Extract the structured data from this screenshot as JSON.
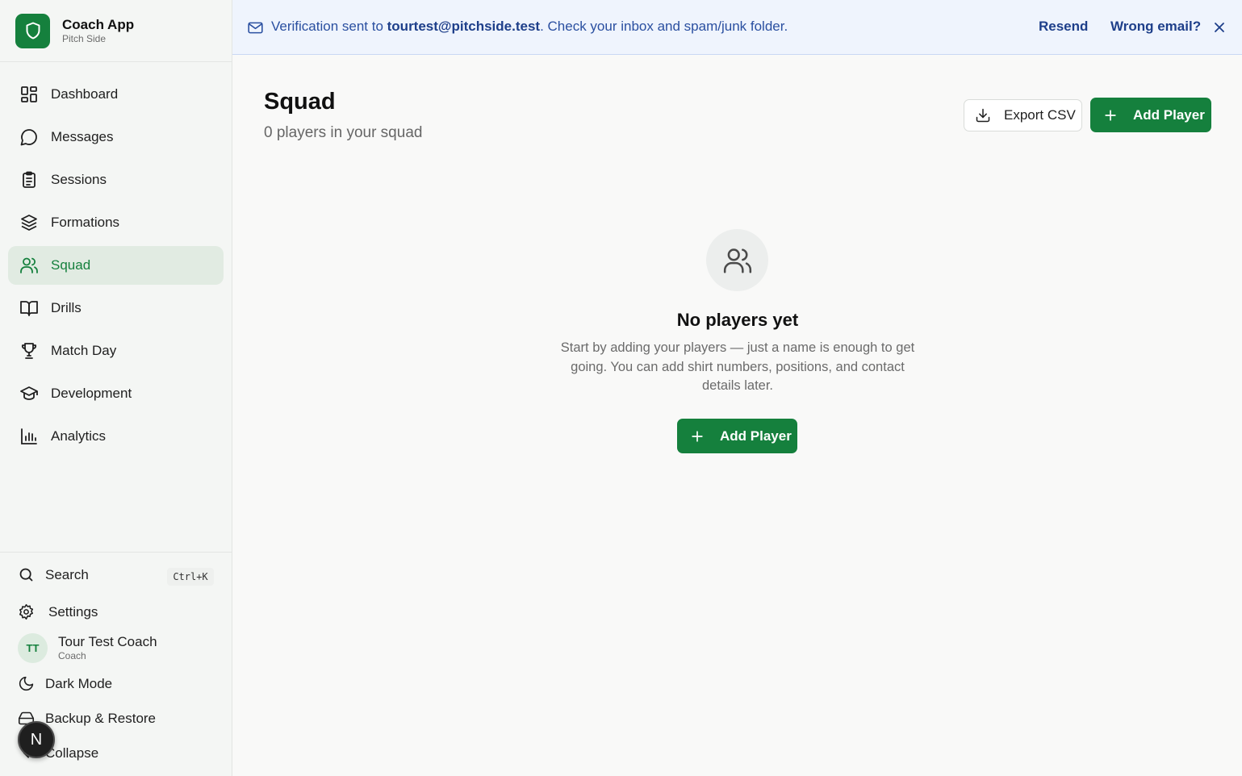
{
  "brand": {
    "title": "Coach App",
    "subtitle": "Pitch Side"
  },
  "nav": {
    "items": [
      {
        "label": "Dashboard",
        "icon": "dashboard-icon"
      },
      {
        "label": "Messages",
        "icon": "message-icon"
      },
      {
        "label": "Sessions",
        "icon": "clipboard-icon"
      },
      {
        "label": "Formations",
        "icon": "layers-icon"
      },
      {
        "label": "Squad",
        "icon": "users-icon",
        "active": true
      },
      {
        "label": "Drills",
        "icon": "book-icon"
      },
      {
        "label": "Match Day",
        "icon": "trophy-icon"
      },
      {
        "label": "Development",
        "icon": "graduation-cap-icon"
      },
      {
        "label": "Analytics",
        "icon": "bar-chart-icon"
      }
    ]
  },
  "sidebar_bottom": {
    "search_label": "Search",
    "search_shortcut": "Ctrl+K",
    "settings_label": "Settings",
    "user_initials": "TT",
    "user_name": "Tour Test Coach",
    "user_role": "Coach",
    "dark_mode_label": "Dark Mode",
    "backup_label": "Backup & Restore",
    "collapse_label": "Collapse",
    "badge_letter": "N"
  },
  "banner": {
    "prefix": "Verification sent to ",
    "email": "tourtest@pitchside.test",
    "suffix": ". Check your inbox and spam/junk folder.",
    "resend_label": "Resend",
    "wrong_email_label": "Wrong email?"
  },
  "main": {
    "title": "Squad",
    "subtitle": "0 players in your squad",
    "export_label": "Export CSV",
    "add_player_label": "Add Player"
  },
  "empty_state": {
    "title": "No players yet",
    "description": "Start by adding your players — just a name is enough to get going. You can add shirt numbers, positions, and contact details later.",
    "button_label": "Add Player"
  },
  "colors": {
    "brand_green": "#15803d",
    "banner_blue": "#1e3f8a",
    "active_bg": "#e1ebe2"
  }
}
